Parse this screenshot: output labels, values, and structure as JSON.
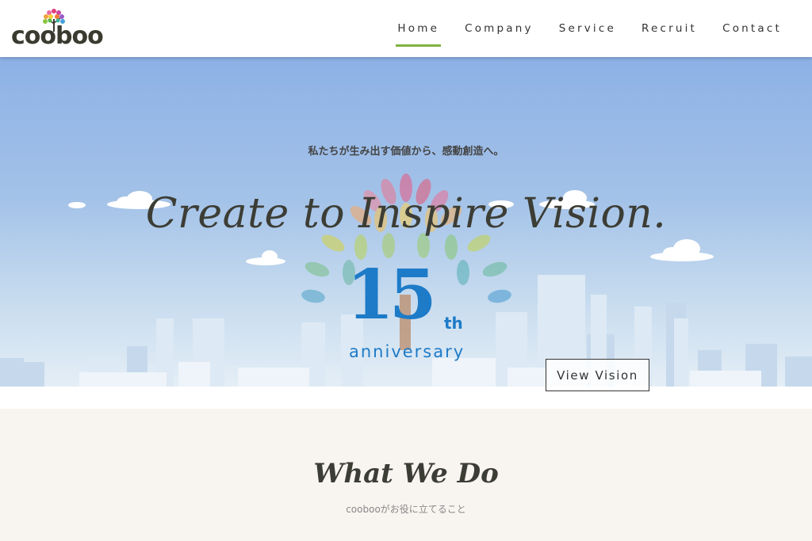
{
  "brand": {
    "name": "cooboo"
  },
  "nav": {
    "items": [
      {
        "label": "Home",
        "active": true
      },
      {
        "label": "Company"
      },
      {
        "label": "Service"
      },
      {
        "label": "Recruit"
      },
      {
        "label": "Contact"
      }
    ]
  },
  "hero": {
    "tagline_jp": "私たちが生み出す価値から、感動創造へ。",
    "headline": "Create to Inspire Vision.",
    "anniversary": {
      "number": "15",
      "suffix": "th",
      "word": "anniversary"
    },
    "cta_label": "View Vision"
  },
  "section": {
    "title": "What We Do",
    "subtitle": "coobooがお役に立てること"
  },
  "colors": {
    "accent_green": "#7fb241",
    "anniversary_blue": "#1d7bc8",
    "sky_top": "#8db1e6",
    "section_bg": "#f8f5f1"
  }
}
